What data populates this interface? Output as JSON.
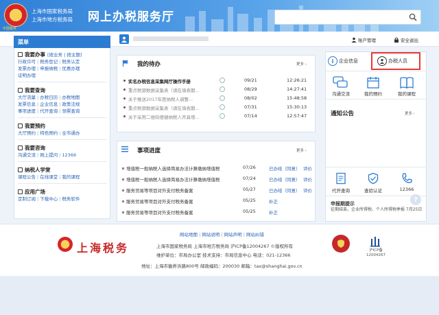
{
  "header": {
    "bureau_line1": "上海市国家税务局",
    "bureau_line2": "上海市地方税务局",
    "emblem_tag": "中国税务",
    "site_title": "网上办税服务厅",
    "search_placeholder": ""
  },
  "userbar": {
    "account_label": "账户管理",
    "logout_label": "安全退出"
  },
  "sidebar": {
    "menu_label": "菜单",
    "sections": [
      {
        "title": "我要办事",
        "title_extra": "[按业务 | 按主题]",
        "rows": [
          [
            "行政许可",
            "税务登记",
            "税务认定"
          ],
          [
            "发票办理",
            "申报纳税",
            "优惠办理"
          ],
          [
            "证明办理"
          ]
        ]
      },
      {
        "title": "我要查询",
        "rows": [
          [
            "大厅流量",
            "办税日历",
            "办税地图"
          ],
          [
            "发票信息",
            "企业信息",
            "政策法规"
          ],
          [
            "事项进度",
            "代开查询",
            "领票查询"
          ]
        ]
      },
      {
        "title": "我要预约",
        "rows": [
          [
            "大厅预约",
            "特色预约",
            "全市通办"
          ]
        ]
      },
      {
        "title": "我要咨询",
        "rows": [
          [
            "沟通交流",
            "网上提问",
            "12366"
          ]
        ]
      },
      {
        "title": "纳税人学堂",
        "rows": [
          [
            "课程公告",
            "在线课堂",
            "我的课程"
          ]
        ]
      },
      {
        "title": "应用广场",
        "rows": [
          [
            "定制订阅",
            "下载中心",
            "税务软件"
          ]
        ]
      }
    ]
  },
  "todo": {
    "title": "我的待办",
    "more": "更多",
    "rows": [
      {
        "text": "实名办税信息采集网厅操作手册",
        "date": "09/21",
        "time": "12:26:21",
        "bold": true
      },
      {
        "text": "重点税源数据采集表（请在填表期...",
        "date": "08/29",
        "time": "14:27:41",
        "bold": false
      },
      {
        "text": "关于推送2017年度纳税人调整...",
        "date": "08/02",
        "time": "15:48:58",
        "bold": false
      },
      {
        "text": "重点税源数据采集表（请在填表期...",
        "date": "07/31",
        "time": "15:30:13",
        "bold": false
      },
      {
        "text": "关于采用二维码便捷纳税人开具增...",
        "date": "07/14",
        "time": "12:57:47",
        "bold": false
      }
    ]
  },
  "progress": {
    "title": "事项进度",
    "more": "更多",
    "rows": [
      {
        "text": "增值税一般纳税人选择简易办法计算缴纳增值税",
        "date": "07/26",
        "status": "已办结（同意）",
        "action": "评价"
      },
      {
        "text": "增值税一般纳税人选择简易办法计算缴纳增值税",
        "date": "07/24",
        "status": "已办结（同意）",
        "action": "评价"
      },
      {
        "text": "服务贸易等项目对外支付税务备案",
        "date": "05/27",
        "status": "已办结（同意）",
        "action": "评价"
      },
      {
        "text": "服务贸易等项目对外支付税务备案",
        "date": "05/25",
        "status": "补正",
        "action": ""
      },
      {
        "text": "服务贸易等项目对外支付税务备案",
        "date": "05/25",
        "status": "补正",
        "action": ""
      }
    ]
  },
  "right": {
    "tab_company": "企业信息",
    "tab_tax_person": "办税人员",
    "quick": [
      "沟通交流",
      "我的预约",
      "我的课程"
    ],
    "notice_title": "通知公告",
    "notice_more": "更多",
    "services": [
      "代开查询",
      "查验认证",
      "12366"
    ],
    "tip_title": "申报期提示",
    "tip_text": "征期结束。企业所得税、个人所得税季报 7月25日"
  },
  "footer": {
    "links": [
      "网站地图",
      "网站说明",
      "网站声明",
      "网站纠错"
    ],
    "logo_text": "上海税务",
    "line1": "上海市国家税务局 上海市地方税务局 沪ICP备12004267 ©版权所有",
    "line2": "维护单位：市局办公室  技术支持：市局信息中心 电话：021-12366",
    "line3": "地址：上海市徽养浜路800号   邮政编码：200030   邮箱：tax@shanghai.gov.cn",
    "badge_text": "沪ICP备\n12004267"
  },
  "colors": {
    "accent": "#2c7cd2",
    "highlight": "#e53935"
  }
}
